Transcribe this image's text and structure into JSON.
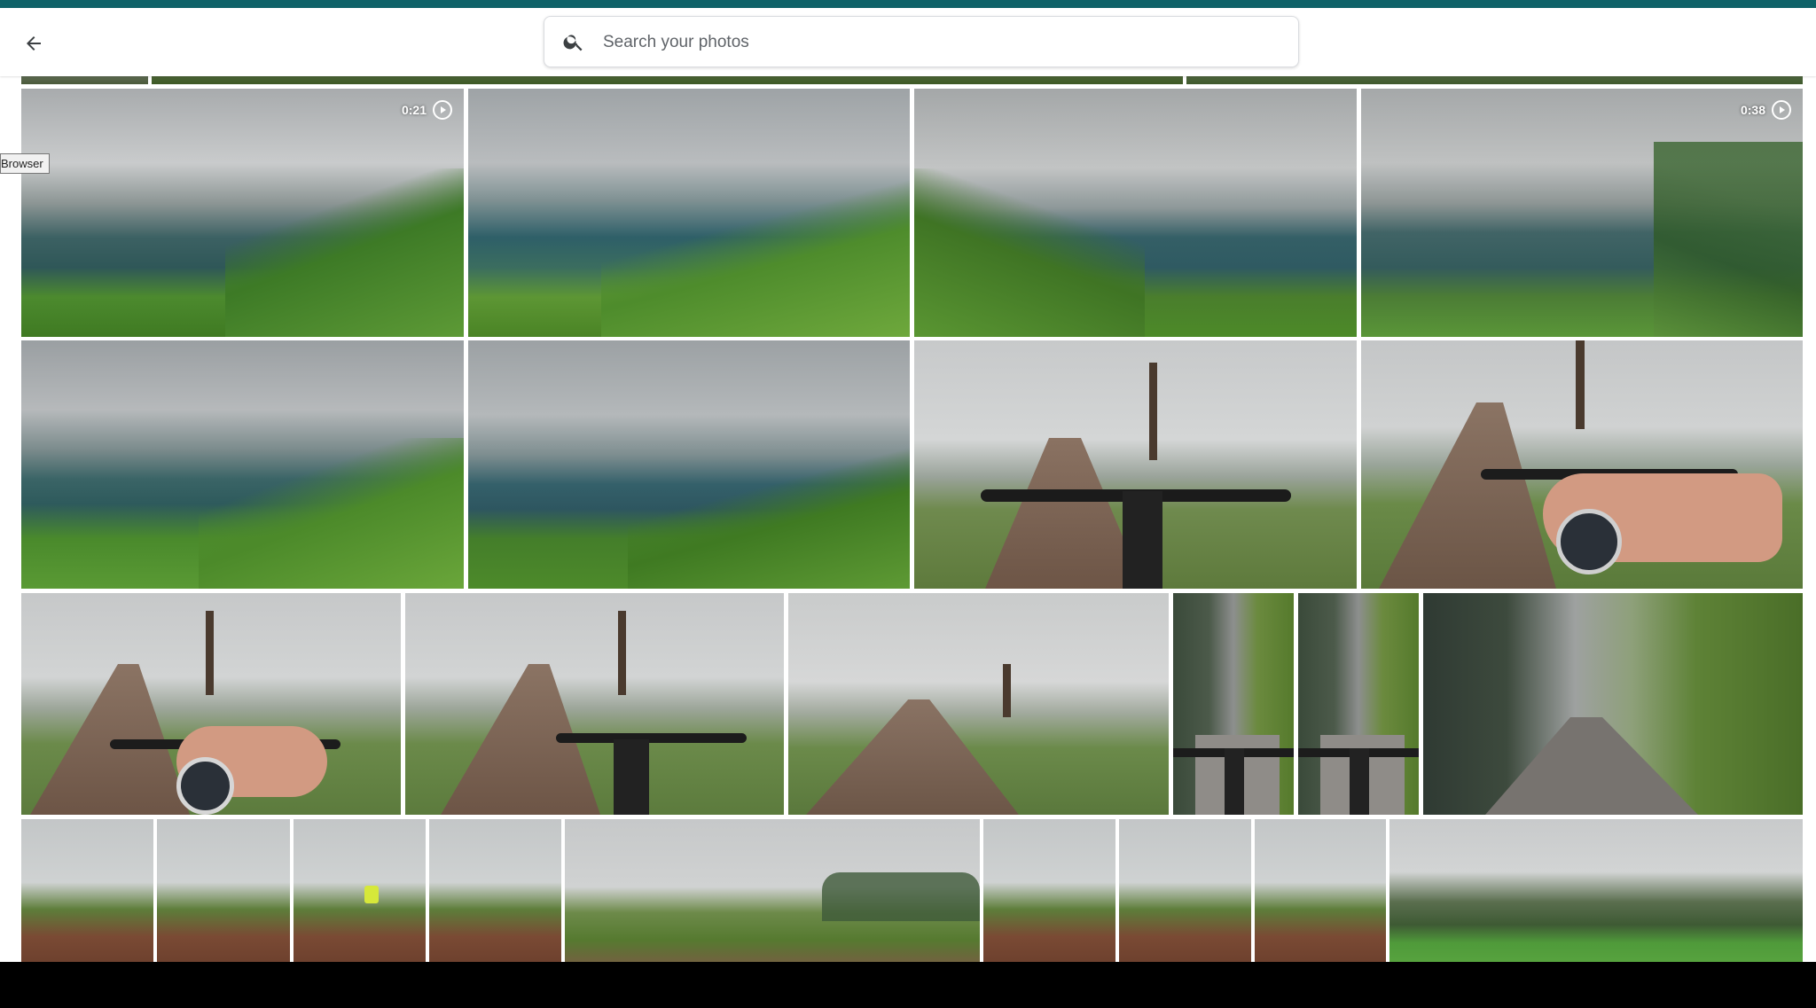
{
  "header": {
    "back_icon": "arrow-left-icon",
    "search": {
      "placeholder": "Search your photos",
      "value": "",
      "icon": "search-icon"
    }
  },
  "tooltip": {
    "text": "Browser"
  },
  "colors": {
    "top_bar": "#0f6268",
    "fog_sky": "#c9cccd",
    "lake": "#2f5c60",
    "grass": "#4f8c2a",
    "road": "#7a5a45"
  },
  "video_badges": [
    {
      "duration": "0:21",
      "icon": "play-circle-icon"
    },
    {
      "duration": "0:38",
      "icon": "play-circle-icon"
    }
  ]
}
